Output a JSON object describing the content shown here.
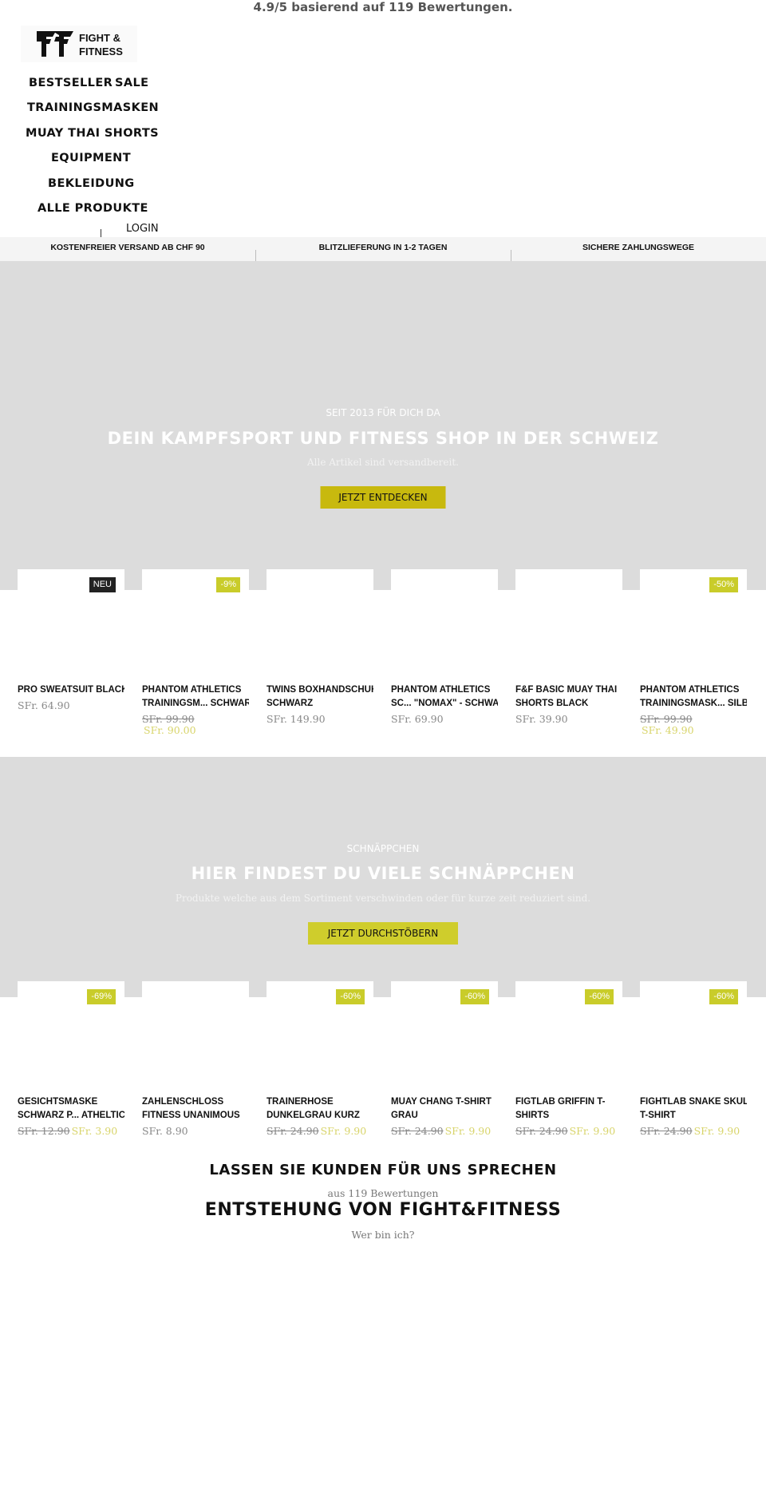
{
  "rating_bar": {
    "text": "4.9/5 basierend auf 119 Bewertungen."
  },
  "logo": {
    "line1": "FIGHT &",
    "line2": "FITNESS"
  },
  "nav": {
    "items": [
      {
        "label": "BESTSELLER"
      },
      {
        "label": "SALE"
      },
      {
        "label": "TRAININGSMASKEN"
      },
      {
        "label": "MUAY THAI SHORTS"
      },
      {
        "label": "EQUIPMENT"
      },
      {
        "label": "BEKLEIDUNG"
      },
      {
        "label": "ALLE PRODUKTE"
      }
    ],
    "login_label": "LOGIN"
  },
  "usp_bar": {
    "items": [
      "KOSTENFREIER VERSAND AB CHF 90",
      "BLITZLIEFERUNG IN 1-2 TAGEN",
      "SICHERE ZAHLUNGSWEGE"
    ]
  },
  "hero_main": {
    "kicker": "SEIT 2013 FÜR DICH DA",
    "title": "DEIN KAMPFSPORT UND FITNESS SHOP IN DER SCHWEIZ",
    "subtitle": "Alle Artikel sind versandbereit.",
    "button_label": "JETZT ENTDECKEN",
    "button_color": "#c8b90e"
  },
  "products_new": [
    {
      "title_line1": "PRO SWEATSUIT BLACK",
      "title_line2": "",
      "badge": "NEU",
      "badge_type": "new",
      "price": "SFr. 64.90",
      "old_price": "",
      "sale_price": ""
    },
    {
      "title_line1": "PHANTOM ATHLETICS",
      "title_line2": "TRAININGSM... SCHWARZ",
      "badge": "-9%",
      "badge_type": "sale",
      "price": "",
      "old_price": "SFr. 99.90",
      "sale_price": "SFr. 90.00"
    },
    {
      "title_line1": "TWINS BOXHANDSCHUHE",
      "title_line2": "SCHWARZ",
      "badge": "",
      "badge_type": "",
      "price": "SFr. 149.90",
      "old_price": "",
      "sale_price": ""
    },
    {
      "title_line1": "PHANTOM ATHLETICS",
      "title_line2": "SC... \"NOMAX\" - SCHWAR",
      "badge": "",
      "badge_type": "",
      "price": "SFr. 69.90",
      "old_price": "",
      "sale_price": ""
    },
    {
      "title_line1": "F&F BASIC MUAY THAI",
      "title_line2": "SHORTS BLACK",
      "badge": "",
      "badge_type": "",
      "price": "SFr. 39.90",
      "old_price": "",
      "sale_price": ""
    },
    {
      "title_line1": "PHANTOM ATHLETICS",
      "title_line2": "TRAININGSMASK... SILBE",
      "badge": "-50%",
      "badge_type": "sale",
      "price": "",
      "old_price": "SFr. 99.90",
      "sale_price": "SFr. 49.90"
    }
  ],
  "hero_sale": {
    "kicker": "SCHNÄPPCHEN",
    "title": "HIER FINDEST DU VIELE SCHNÄPPCHEN",
    "subtitle": "Produkte welche aus dem Sortiment verschwinden oder für kurze zeit reduziert sind.",
    "button_label": "JETZT DURCHSTÖBERN",
    "button_color": "#cfcd2c"
  },
  "products_sale": [
    {
      "title_line1": "GESICHTSMASKE",
      "title_line2": "SCHWARZ P... ATHELTICS",
      "badge": "-69%",
      "badge_type": "sale",
      "price": "",
      "old_price": "SFr. 12.90",
      "sale_price": "SFr. 3.90"
    },
    {
      "title_line1": "ZAHLENSCHLOSS",
      "title_line2": "FITNESS UNANIMOUS",
      "badge": "",
      "badge_type": "",
      "price": "SFr. 8.90",
      "old_price": "",
      "sale_price": ""
    },
    {
      "title_line1": "TRAINERHOSE",
      "title_line2": "DUNKELGRAU KURZ",
      "badge": "-60%",
      "badge_type": "sale",
      "price": "",
      "old_price": "SFr. 24.90",
      "sale_price": "SFr. 9.90"
    },
    {
      "title_line1": "MUAY CHANG T-SHIRT",
      "title_line2": "GRAU",
      "badge": "-60%",
      "badge_type": "sale",
      "price": "",
      "old_price": "SFr. 24.90",
      "sale_price": "SFr. 9.90"
    },
    {
      "title_line1": "FIGTLAB GRIFFIN T-",
      "title_line2": "SHIRTS",
      "badge": "-60%",
      "badge_type": "sale",
      "price": "",
      "old_price": "SFr. 24.90",
      "sale_price": "SFr. 9.90"
    },
    {
      "title_line1": "FIGHTLAB SNAKE SKULL",
      "title_line2": "T-SHIRT",
      "badge": "-60%",
      "badge_type": "sale",
      "price": "",
      "old_price": "SFr. 24.90",
      "sale_price": "SFr. 9.90"
    }
  ],
  "reviews": {
    "heading": "LASSEN SIE KUNDEN FÜR UNS SPRECHEN",
    "count_text": "aus 119 Bewertungen"
  },
  "about": {
    "heading": "ENTSTEHUNG VON FIGHT&FITNESS",
    "subtitle": "Wer bin ich?"
  }
}
